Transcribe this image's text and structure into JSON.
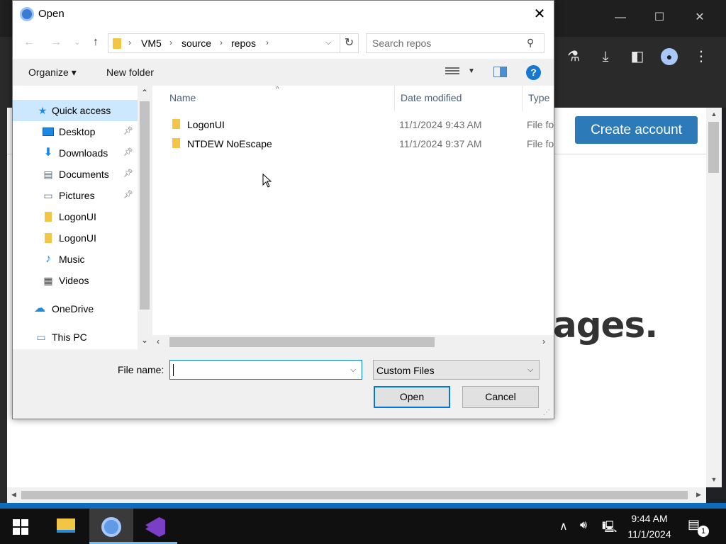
{
  "browser": {
    "create_account_label": "Create account",
    "headline_fragment": "ages."
  },
  "dialog": {
    "title": "Open",
    "close_label": "✕",
    "breadcrumb": [
      "VM5",
      "source",
      "repos"
    ],
    "search_placeholder": "Search repos",
    "toolbar": {
      "organize_label": "Organize ▾",
      "new_folder_label": "New folder",
      "help_label": "?"
    },
    "nav_pane": [
      {
        "label": "Quick access",
        "icon": "star-icon",
        "selected": true,
        "pinned": false
      },
      {
        "label": "Desktop",
        "icon": "desktop-icon",
        "selected": false,
        "pinned": true
      },
      {
        "label": "Downloads",
        "icon": "download-arrow-icon",
        "selected": false,
        "pinned": true
      },
      {
        "label": "Documents",
        "icon": "documents-icon",
        "selected": false,
        "pinned": true
      },
      {
        "label": "Pictures",
        "icon": "pictures-icon",
        "selected": false,
        "pinned": true
      },
      {
        "label": "LogonUI",
        "icon": "folder-icon",
        "selected": false,
        "pinned": false
      },
      {
        "label": "LogonUI",
        "icon": "folder-icon",
        "selected": false,
        "pinned": false
      },
      {
        "label": "Music",
        "icon": "music-note-icon",
        "selected": false,
        "pinned": false
      },
      {
        "label": "Videos",
        "icon": "film-icon",
        "selected": false,
        "pinned": false
      },
      {
        "label": "OneDrive",
        "icon": "cloud-icon",
        "selected": false,
        "pinned": false
      },
      {
        "label": "This PC",
        "icon": "computer-icon",
        "selected": false,
        "pinned": false
      }
    ],
    "columns": {
      "name": "Name",
      "date_modified": "Date modified",
      "type": "Type"
    },
    "files": [
      {
        "name": "LogonUI",
        "date_modified": "11/1/2024 9:43 AM",
        "type": "File fo"
      },
      {
        "name": "NTDEW NoEscape",
        "date_modified": "11/1/2024 9:37 AM",
        "type": "File fo"
      }
    ],
    "file_name_label": "File name:",
    "file_name_value": "",
    "file_type_filter": "Custom Files",
    "open_button": "Open",
    "cancel_button": "Cancel"
  },
  "taskbar": {
    "time": "9:44 AM",
    "date": "11/1/2024",
    "notification_count": "1"
  }
}
